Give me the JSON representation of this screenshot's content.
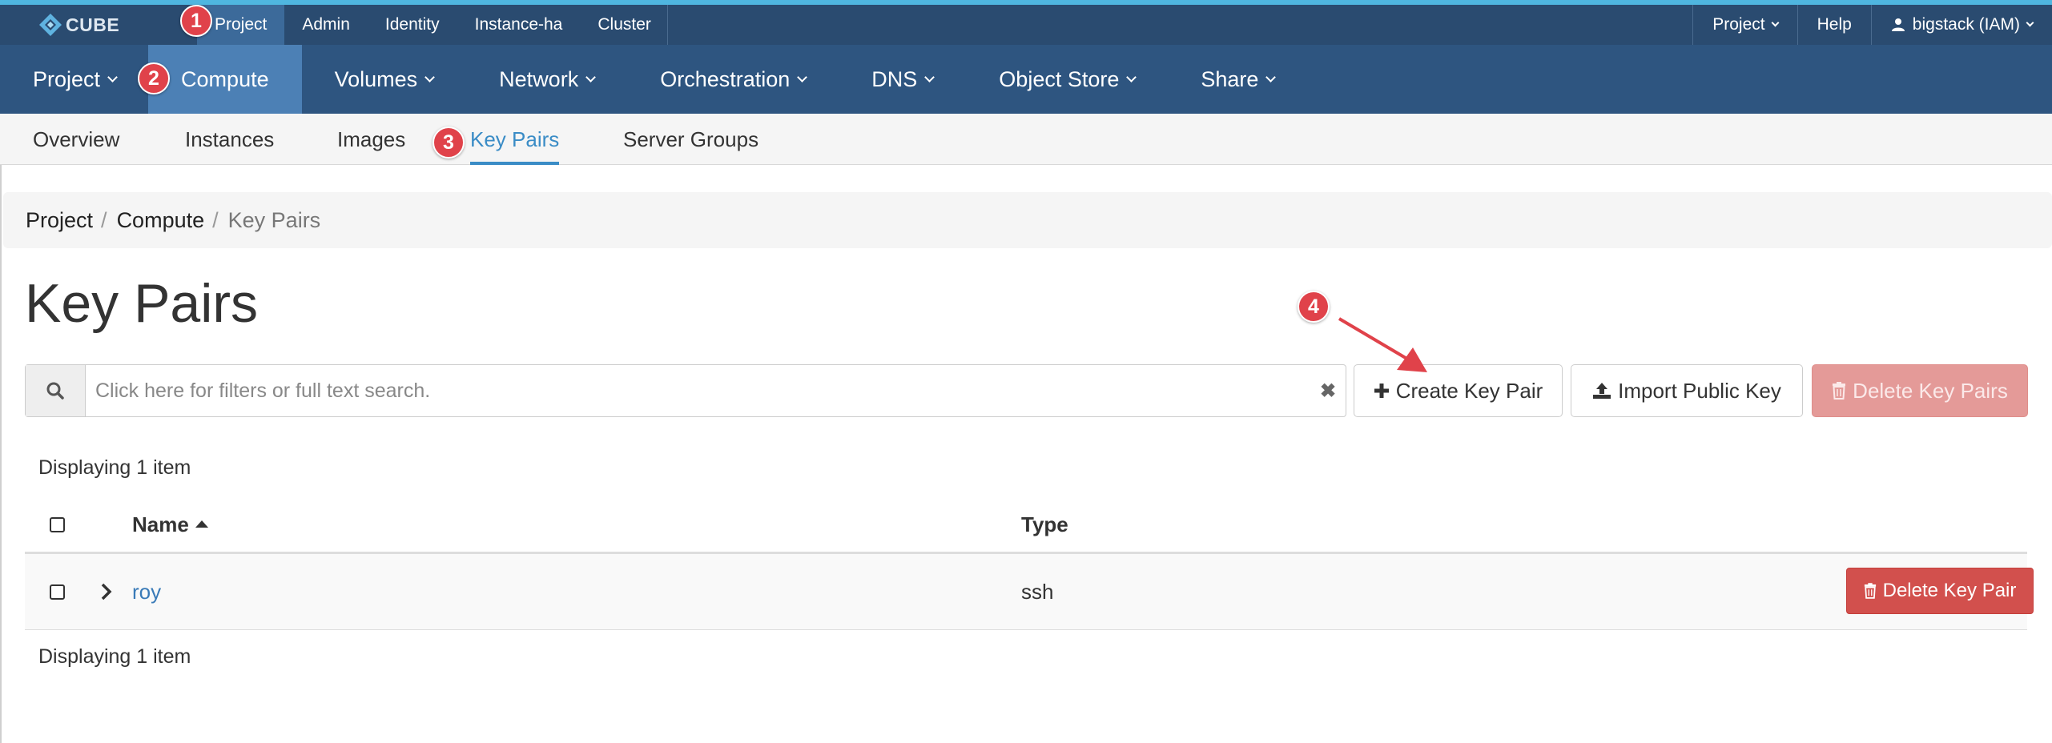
{
  "brand": {
    "name": "CUBE"
  },
  "topnav": {
    "items": [
      "Project",
      "Admin",
      "Identity",
      "Instance-ha",
      "Cluster"
    ],
    "active_index": 0
  },
  "topright": {
    "project_menu": "Project",
    "help": "Help",
    "user": "bigstack (IAM)"
  },
  "secondnav": {
    "items": [
      "Project",
      "Compute",
      "Volumes",
      "Network",
      "Orchestration",
      "DNS",
      "Object Store",
      "Share"
    ],
    "active_index": 1
  },
  "thirdnav": {
    "items": [
      "Overview",
      "Instances",
      "Images",
      "Key Pairs",
      "Server Groups"
    ],
    "active_index": 3
  },
  "breadcrumb": [
    "Project",
    "Compute",
    "Key Pairs"
  ],
  "breadcrumb_sep": "/",
  "page_title": "Key Pairs",
  "search": {
    "placeholder": "Click here for filters or full text search.",
    "value": ""
  },
  "actions": {
    "create": "Create Key Pair",
    "import": "Import Public Key",
    "delete_all": "Delete Key Pairs"
  },
  "count_label": "Displaying 1 item",
  "table": {
    "columns": [
      "Name",
      "Type"
    ],
    "rows": [
      {
        "name": "roy",
        "type": "ssh",
        "action": "Delete Key Pair"
      }
    ]
  },
  "annotations": [
    "1",
    "2",
    "3",
    "4"
  ],
  "colors": {
    "topbar": "#2a4b70",
    "secondnav": "#2e5580",
    "active_tab": "#4c80b5",
    "link": "#3a8cc6",
    "danger": "#d2504d",
    "marker": "#e0424a"
  }
}
